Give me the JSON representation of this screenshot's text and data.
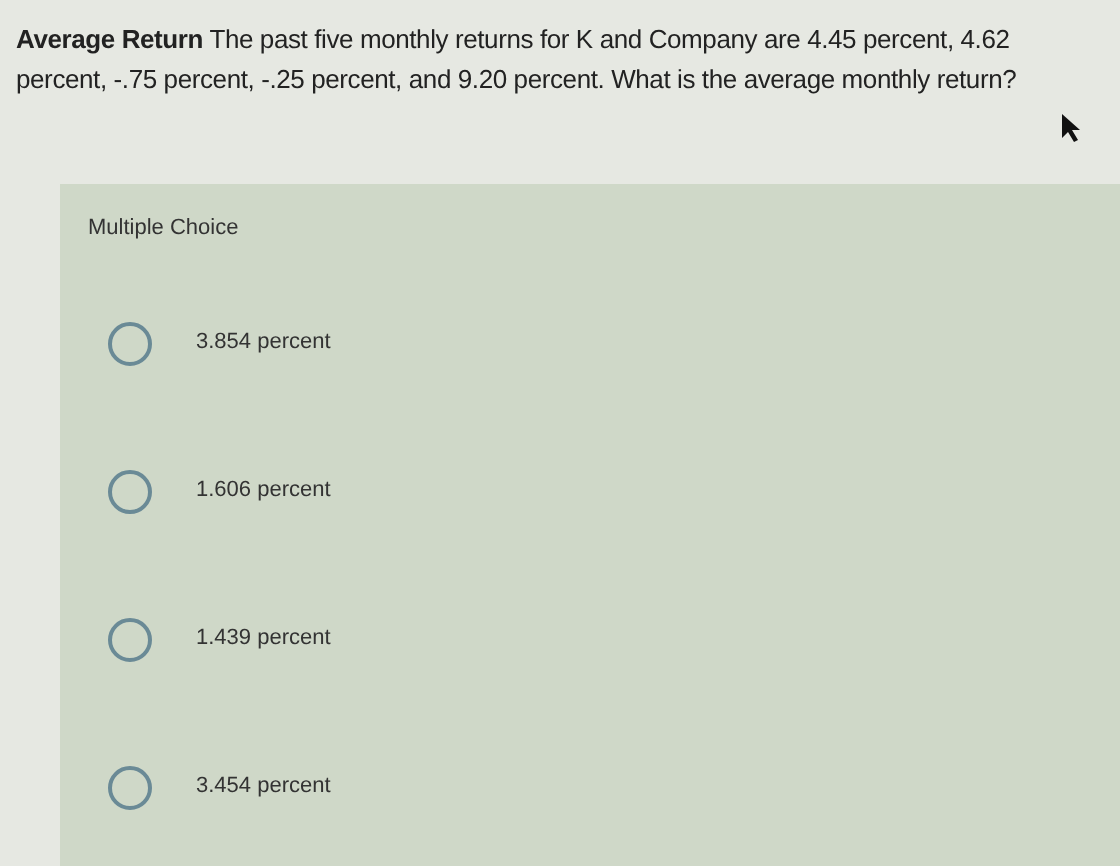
{
  "question": {
    "text": "**Average Return** The past five monthly returns for K and Company are 4.45 percent, 4.62 percent, -.75 percent, -.25 percent, and 9.20 percent. What is the average monthly return?"
  },
  "panel": {
    "label": "Multiple Choice"
  },
  "options": [
    {
      "label": "3.854 percent",
      "selected": false
    },
    {
      "label": "1.606 percent",
      "selected": false
    },
    {
      "label": "1.439 percent",
      "selected": false
    },
    {
      "label": "3.454 percent",
      "selected": false
    }
  ]
}
